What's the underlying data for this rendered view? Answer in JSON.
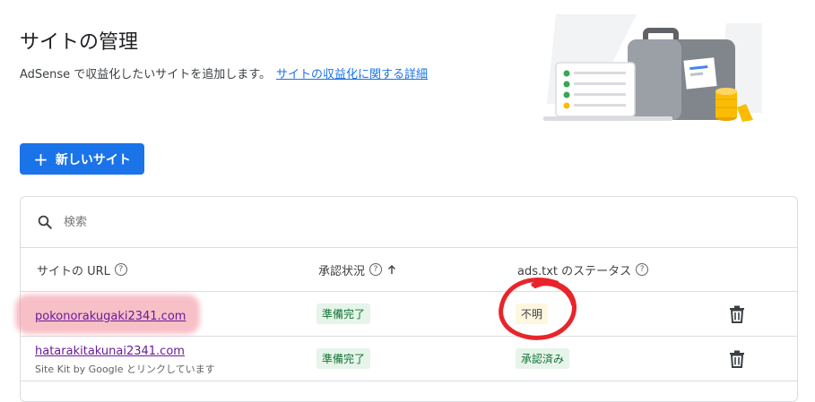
{
  "page": {
    "title": "サイトの管理",
    "intro_text": "AdSense で収益化したいサイトを追加します。",
    "intro_link": "サイトの収益化に関する詳細"
  },
  "toolbar": {
    "add_site_label": "新しいサイト"
  },
  "search": {
    "placeholder": "検索"
  },
  "table": {
    "headers": {
      "url": "サイトの URL",
      "approval": "承認状況",
      "ads_txt": "ads.txt のステータス"
    },
    "rows": [
      {
        "url": "pokonorakugaki2341.com",
        "subtext": "",
        "approval": "準備完了",
        "ads_txt": "不明"
      },
      {
        "url": "hatarakitakunai2341.com",
        "subtext": "Site Kit by Google とリンクしています",
        "approval": "準備完了",
        "ads_txt": "承認済み"
      }
    ]
  },
  "colors": {
    "accent": "#1a73e8",
    "status_ready_bg": "#e6f4ea",
    "status_ready_text": "#137333",
    "annotation_red": "#e8252b"
  }
}
